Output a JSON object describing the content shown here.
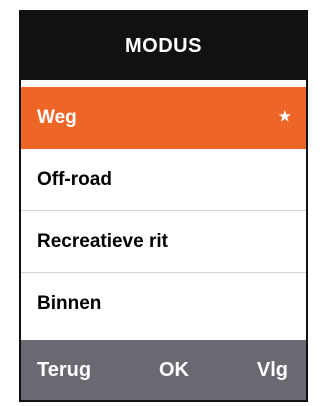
{
  "header": {
    "title": "MODUS"
  },
  "menu": {
    "selected_index": 0,
    "items": [
      {
        "label": "Weg",
        "favorite_icon": "star-icon",
        "star": "★"
      },
      {
        "label": "Off-road"
      },
      {
        "label": "Recreatieve rit"
      },
      {
        "label": "Binnen"
      }
    ]
  },
  "footer": {
    "back_label": "Terug",
    "ok_label": "OK",
    "next_label": "Vlg"
  },
  "colors": {
    "header_bg": "#111111",
    "selected_bg": "#ee6627",
    "footer_bg": "#6b6872"
  }
}
